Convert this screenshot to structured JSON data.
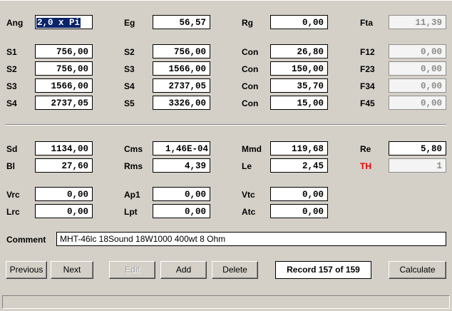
{
  "row1": {
    "ang": {
      "label": "Ang",
      "value": "2,0 x Pi"
    },
    "eg": {
      "label": "Eg",
      "value": "56,57"
    },
    "rg": {
      "label": "Rg",
      "value": "0,00"
    },
    "fta": {
      "label": "Fta",
      "value": "11,39"
    }
  },
  "block1": [
    {
      "l1": "S1",
      "v1": "756,00",
      "l2": "S2",
      "v2": "756,00",
      "l3": "Con",
      "v3": "26,80",
      "l4": "F12",
      "v4": "0,00"
    },
    {
      "l1": "S2",
      "v1": "756,00",
      "l2": "S3",
      "v2": "1566,00",
      "l3": "Con",
      "v3": "150,00",
      "l4": "F23",
      "v4": "0,00"
    },
    {
      "l1": "S3",
      "v1": "1566,00",
      "l2": "S4",
      "v2": "2737,05",
      "l3": "Con",
      "v3": "35,70",
      "l4": "F34",
      "v4": "0,00"
    },
    {
      "l1": "S4",
      "v1": "2737,05",
      "l2": "S5",
      "v2": "3326,00",
      "l3": "Con",
      "v3": "15,00",
      "l4": "F45",
      "v4": "0,00"
    }
  ],
  "block2": {
    "sd": {
      "label": "Sd",
      "value": "1134,00"
    },
    "cms": {
      "label": "Cms",
      "value": "1,46E-04"
    },
    "mmd": {
      "label": "Mmd",
      "value": "119,68"
    },
    "re": {
      "label": "Re",
      "value": "5,80"
    },
    "bl": {
      "label": "Bl",
      "value": "27,60"
    },
    "rms": {
      "label": "Rms",
      "value": "4,39"
    },
    "le": {
      "label": "Le",
      "value": "2,45"
    },
    "th": {
      "label": "TH",
      "value": "1"
    }
  },
  "block3": {
    "vrc": {
      "label": "Vrc",
      "value": "0,00"
    },
    "ap1": {
      "label": "Ap1",
      "value": "0,00"
    },
    "vtc": {
      "label": "Vtc",
      "value": "0,00"
    },
    "lrc": {
      "label": "Lrc",
      "value": "0,00"
    },
    "lpt": {
      "label": "Lpt",
      "value": "0,00"
    },
    "atc": {
      "label": "Atc",
      "value": "0,00"
    }
  },
  "comment": {
    "label": "Comment",
    "value": "MHT-46lc 18Sound 18W1000 400wt 8 Ohm"
  },
  "buttons": {
    "previous": "Previous",
    "next": "Next",
    "edit": "Edit",
    "add": "Add",
    "delete": "Delete",
    "calculate": "Calculate"
  },
  "record": "Record 157 of 159",
  "colors": {
    "background": "#d4d0c8",
    "selection": "#0a246a",
    "th_label": "#ee0000"
  }
}
